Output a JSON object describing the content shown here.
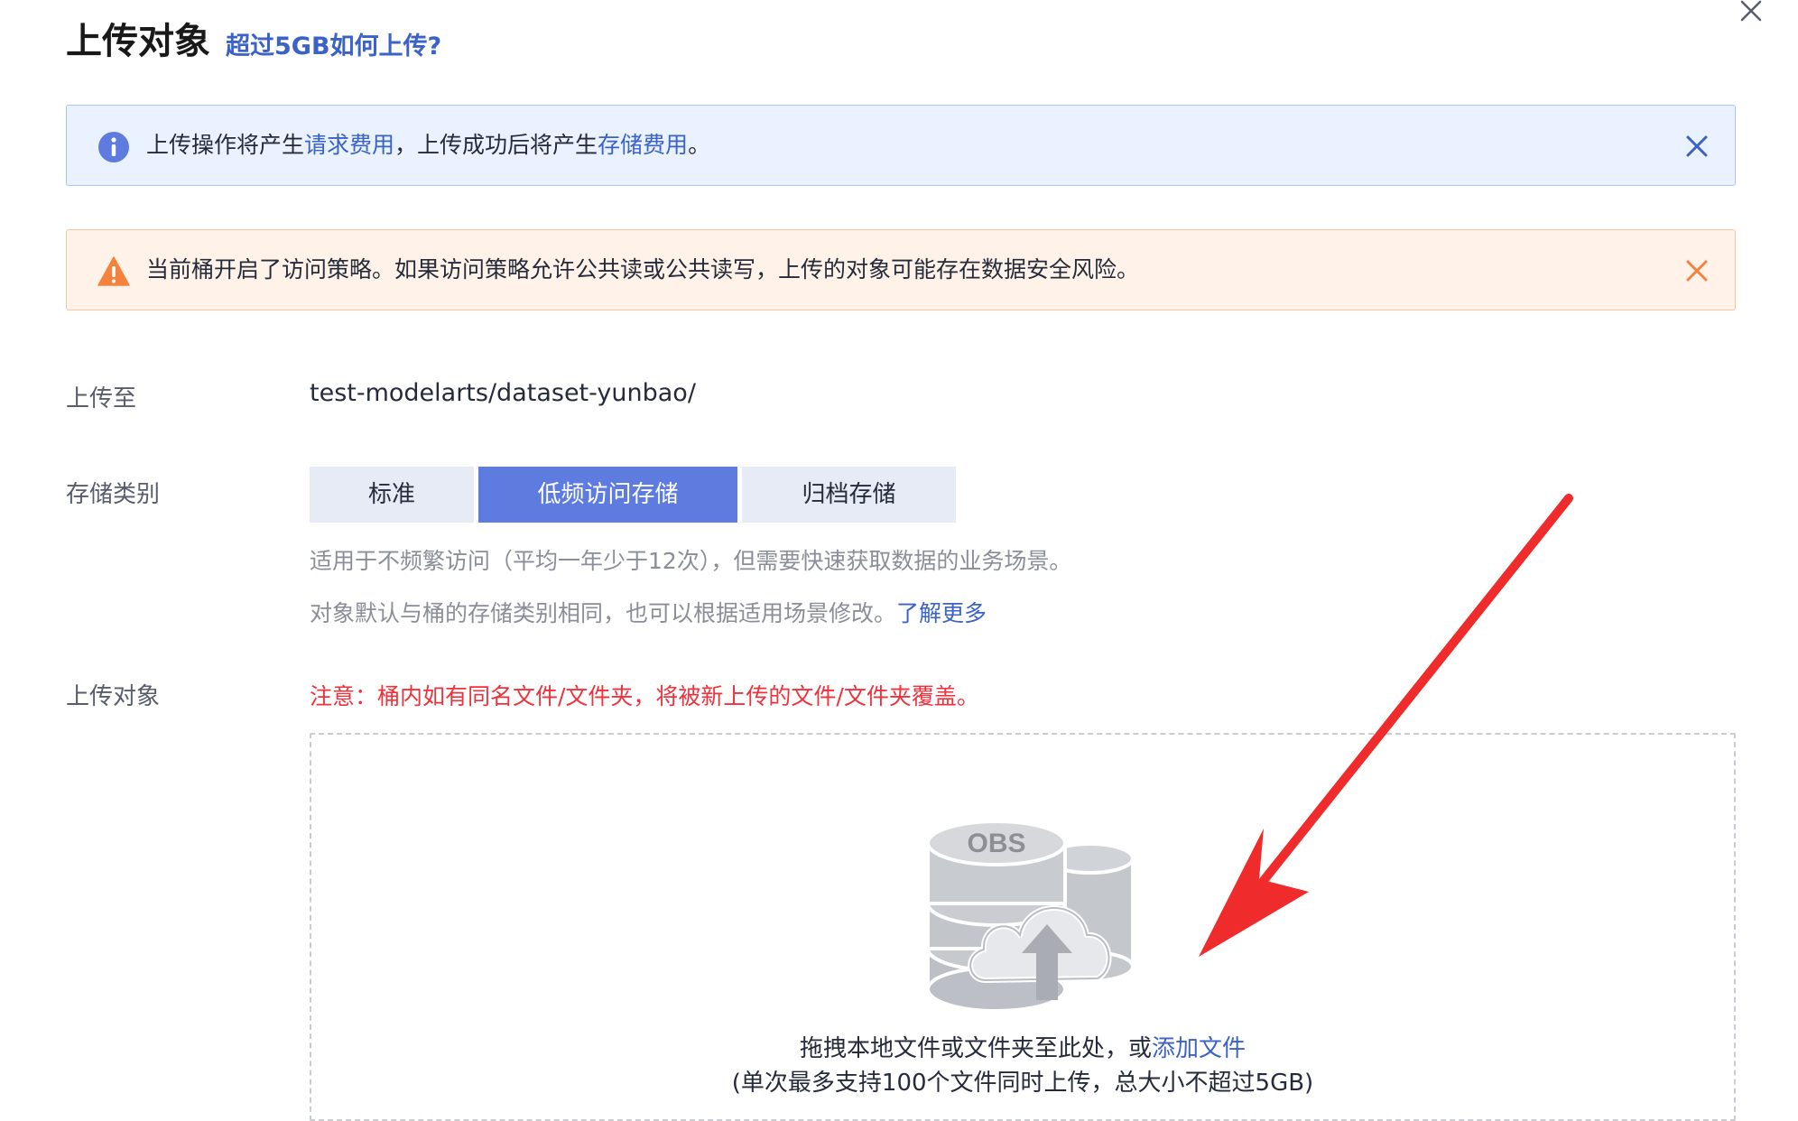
{
  "dialog": {
    "title": "上传对象",
    "help_link": "超过5GB如何上传?",
    "close_icon": "close-icon"
  },
  "info_alert": {
    "icon": "info-icon",
    "text_1": "上传操作将产生",
    "link_1": "请求费用",
    "text_2": "，上传成功后将产生",
    "link_2": "存储费用",
    "text_3": "。",
    "color": "#3a62c7"
  },
  "warning_alert": {
    "icon": "warning-icon",
    "text": "当前桶开启了访问策略。如果访问策略允许公共读或公共读写，上传的对象可能存在数据安全风险。",
    "color": "#f5823c"
  },
  "upload_to": {
    "label": "上传至",
    "value": "test-modelarts/dataset-yunbao/"
  },
  "storage_class": {
    "label": "存储类别",
    "options": [
      "标准",
      "低频访问存储",
      "归档存储"
    ],
    "selected": "低频访问存储",
    "description": "适用于不频繁访问（平均一年少于12次），但需要快速获取数据的业务场景。",
    "note_text": "对象默认与桶的存储类别相同，也可以根据适用场景修改。",
    "note_link": "了解更多",
    "active_color": "#5e7ce0"
  },
  "upload_object": {
    "label": "上传对象",
    "warning": "注意：桶内如有同名文件/文件夹，将被新上传的文件/文件夹覆盖。",
    "warning_color": "#f0313b",
    "dropzone": {
      "illustration_icon": "obs-upload-icon",
      "illustration_label": "OBS",
      "line1_text": "拖拽本地文件或文件夹至此处，或",
      "line1_link": "添加文件",
      "line2": "(单次最多支持100个文件同时上传，总大小不超过5GB)"
    }
  },
  "annotation": {
    "icon": "red-arrow-icon",
    "color": "#f02b2b"
  }
}
